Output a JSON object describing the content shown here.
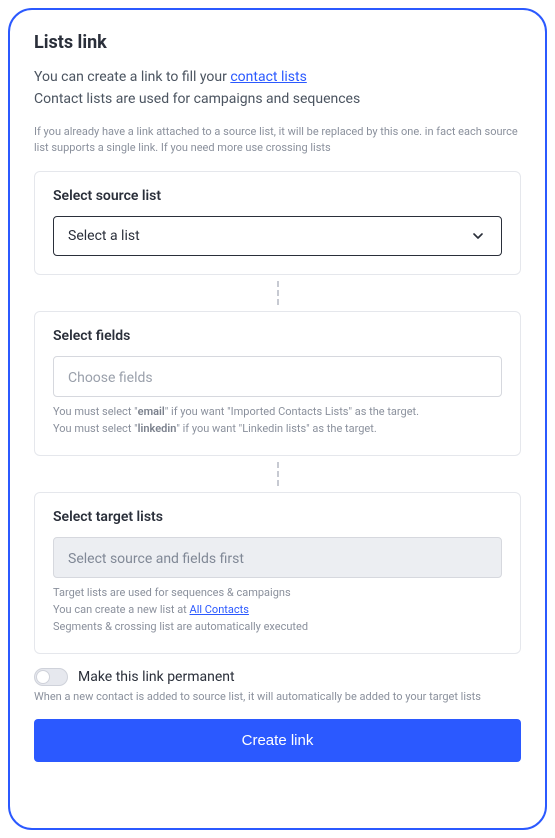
{
  "page_title": "Lists link",
  "subtitle_prefix": "You can create a link to fill your ",
  "subtitle_link": "contact lists",
  "subtitle2": "Contact lists are used for campaigns and sequences",
  "description": "If you already have a link attached to a source list, it will be replaced by this one. in fact each source list supports a single link. If you need more use crossing lists",
  "source": {
    "title": "Select source list",
    "placeholder": "Select a list"
  },
  "fields": {
    "title": "Select fields",
    "placeholder": "Choose fields",
    "hint1_a": "You must select \"",
    "hint1_b": "email",
    "hint1_c": "\" if you want \"Imported Contacts Lists\" as the target.",
    "hint2_a": "You must select \"",
    "hint2_b": "linkedin",
    "hint2_c": "\" if you want \"Linkedin lists\" as the target."
  },
  "target": {
    "title": "Select target lists",
    "placeholder": "Select source and fields first",
    "hint1": "Target lists are used for sequences & campaigns",
    "hint2_a": "You can create a new list at ",
    "hint2_link": "All Contacts",
    "hint3": "Segments & crossing list are automatically executed"
  },
  "permanent": {
    "label": "Make this link permanent",
    "desc": "When a new contact is added to source list, it will automatically be added to your target lists"
  },
  "button": "Create link"
}
